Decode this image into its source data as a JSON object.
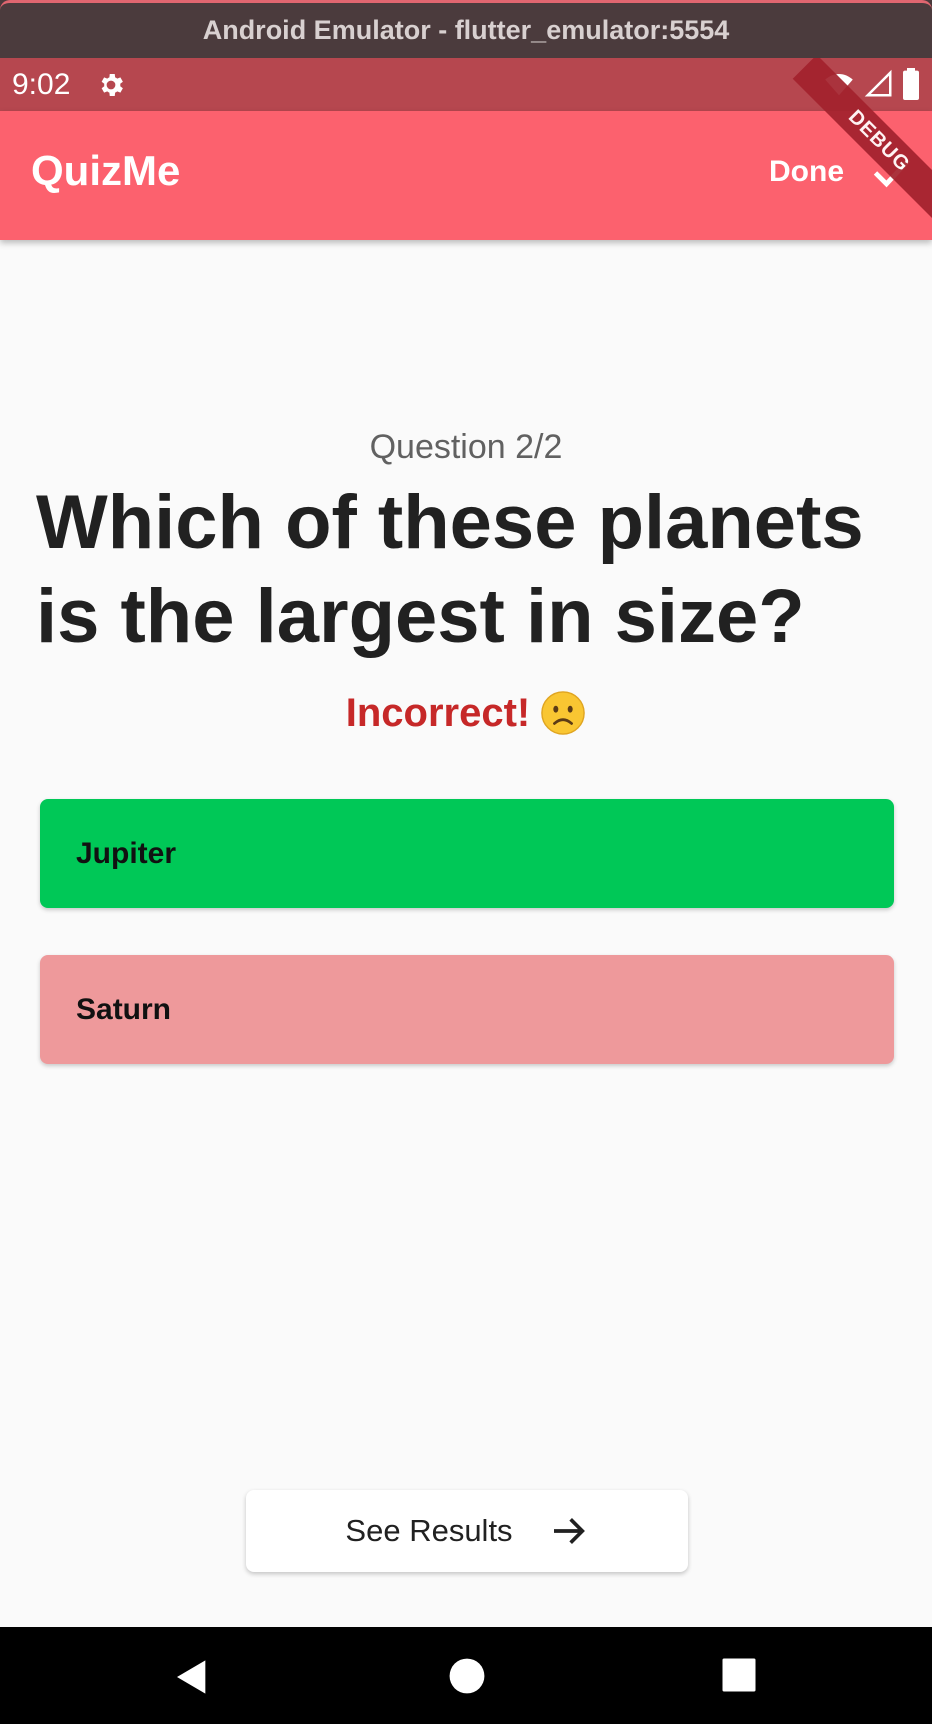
{
  "window": {
    "title": "Android Emulator - flutter_emulator:5554"
  },
  "status_bar": {
    "time": "9:02",
    "icons": [
      "gear-icon",
      "wifi-icon",
      "signal-icon",
      "battery-icon"
    ]
  },
  "app_bar": {
    "title": "QuizMe",
    "done_label": "Done",
    "done_icon": "check-icon",
    "debug_label": "DEBUG"
  },
  "quiz": {
    "question_count": "Question 2/2",
    "question": "Which of these planets is the largest in size?",
    "feedback": "Incorrect!",
    "feedback_icon": "sad-face-emoji",
    "answers": [
      {
        "label": "Jupiter",
        "state": "correct",
        "color": "#00c857"
      },
      {
        "label": "Saturn",
        "state": "selected-incorrect",
        "color": "#ee999b"
      }
    ],
    "results_button": {
      "label": "See Results",
      "icon": "arrow-right-icon"
    }
  },
  "colors": {
    "app_bar": "#fc616e",
    "status_bar": "#b6474f",
    "feedback": "#c62828"
  },
  "nav_bar": {
    "icons": [
      "back-icon",
      "home-icon",
      "recents-icon"
    ]
  }
}
